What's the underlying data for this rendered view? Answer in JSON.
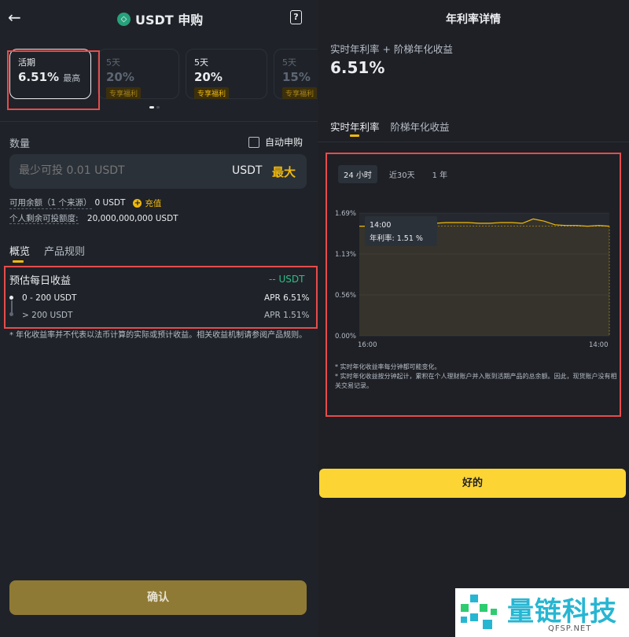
{
  "left": {
    "title": "USDT 申购",
    "terms": [
      {
        "name": "活期",
        "rate": "6.51%",
        "sub": "最高",
        "badge": ""
      },
      {
        "name": "5天",
        "rate": "20%",
        "sub": "",
        "badge": "专享福利"
      },
      {
        "name": "5天",
        "rate": "20%",
        "sub": "",
        "badge": "专享福利"
      },
      {
        "name": "5天",
        "rate": "15%",
        "sub": "",
        "badge": "专享福利"
      }
    ],
    "amount_label": "数量",
    "auto_subscribe": "自动申购",
    "input_placeholder": "最少可投 0.01 USDT",
    "input_unit": "USDT",
    "max_label": "最大",
    "balance_label": "可用余额（1 个来源）",
    "balance_value": "0 USDT",
    "recharge": "充值",
    "limit_label": "个人剩余可投额度:",
    "limit_value": "20,000,000,000 USDT",
    "tabs": [
      "概览",
      "产品规则"
    ],
    "estimate_title": "预估每日收益",
    "estimate_value": "-- USDT",
    "tiers": [
      {
        "range": "0 - 200 USDT",
        "apr": "APR 6.51%"
      },
      {
        "range": "> 200 USDT",
        "apr": "APR 1.51%"
      }
    ],
    "note": "* 年化收益率并不代表以法币计算的实际或预计收益。相关收益机制请参阅产品规则。",
    "confirm": "确认"
  },
  "right": {
    "title": "年利率详情",
    "subtitle": "实时年利率 + 阶梯年化收益",
    "rate": "6.51%",
    "tabs": [
      "实时年利率",
      "阶梯年化收益"
    ],
    "ranges": [
      "24 小时",
      "近30天",
      "1 年"
    ],
    "tooltip_time": "14:00",
    "tooltip_label": "年利率:",
    "tooltip_value": "1.51 %",
    "notes": [
      "* 实时年化收益率每分钟都可能变化。",
      "* 实时年化收益按分钟起计，累积在个人理财账户并入账到活期产品的总余额。因此，现货账户没有相关交易记录。"
    ],
    "ok": "好的"
  },
  "chart_data": {
    "type": "line",
    "x": [
      "16:00",
      "",
      "",
      "",
      "",
      "",
      "",
      "",
      "",
      "",
      "",
      "",
      "",
      "",
      "",
      "",
      "",
      "",
      "",
      "",
      "",
      "",
      "",
      "14:00"
    ],
    "series": [
      {
        "values": [
          1.51,
          1.51,
          1.56,
          1.55,
          1.56,
          1.56,
          1.55,
          1.55,
          1.56,
          1.56,
          1.56,
          1.55,
          1.55,
          1.56,
          1.56,
          1.55,
          1.61,
          1.58,
          1.53,
          1.52,
          1.52,
          1.51,
          1.52,
          1.51
        ]
      }
    ],
    "yticks": [
      "1.69%",
      "1.13%",
      "0.56%",
      "0.00%"
    ],
    "xticks": [
      "16:00",
      "14:00"
    ],
    "ylim": [
      0,
      1.69
    ],
    "line_color": "#f0b90b"
  },
  "watermark": {
    "text": "量链科技",
    "url": "QFSP.NET"
  }
}
